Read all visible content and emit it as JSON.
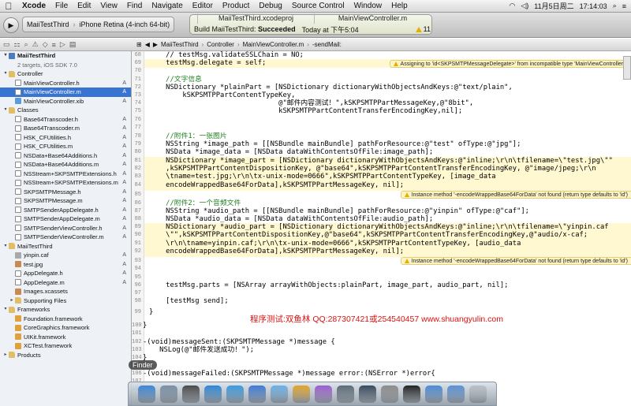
{
  "menubar": {
    "apple": "",
    "items": [
      "Xcode",
      "File",
      "Edit",
      "View",
      "Find",
      "Navigate",
      "Editor",
      "Product",
      "Debug",
      "Source Control",
      "Window",
      "Help"
    ],
    "status": {
      "clock": "17:14:03",
      "date": "11月5日周二"
    }
  },
  "toolbar": {
    "run_icon": "play-icon",
    "scheme_target": "MaiiTestThird",
    "scheme_device": "iPhone Retina (4-inch 64-bit)",
    "activity_tabs": [
      "MaiiTestThird.xcodeproj",
      "MainViewController.m"
    ],
    "activity_status_prefix": "Build MaiiTestThird:",
    "activity_status": "Succeeded",
    "activity_time": "Today at 下午5:04",
    "warning_count": "11"
  },
  "navigator": {
    "project": "MaiiTestThird",
    "project_sub": "2 targets, iOS SDK 7.0",
    "items": [
      {
        "label": "Controller",
        "kind": "folder",
        "indent": 1,
        "disc": "▾",
        "status": ""
      },
      {
        "label": "MainViewController.h",
        "kind": "h",
        "indent": 2,
        "disc": "",
        "status": "A"
      },
      {
        "label": "MainViewController.m",
        "kind": "m",
        "indent": 2,
        "disc": "",
        "status": "A",
        "selected": true
      },
      {
        "label": "MainViewController.xib",
        "kind": "xib",
        "indent": 2,
        "disc": "",
        "status": "A"
      },
      {
        "label": "Classes",
        "kind": "folder",
        "indent": 1,
        "disc": "▾",
        "status": ""
      },
      {
        "label": "Base64Transcoder.h",
        "kind": "h",
        "indent": 2,
        "disc": "",
        "status": "A"
      },
      {
        "label": "Base64Transcoder.m",
        "kind": "m",
        "indent": 2,
        "disc": "",
        "status": "A"
      },
      {
        "label": "HSK_CFUtilities.h",
        "kind": "h",
        "indent": 2,
        "disc": "",
        "status": "A"
      },
      {
        "label": "HSK_CFUtilities.m",
        "kind": "m",
        "indent": 2,
        "disc": "",
        "status": "A"
      },
      {
        "label": "NSData+Base64Additions.h",
        "kind": "h",
        "indent": 2,
        "disc": "",
        "status": "A"
      },
      {
        "label": "NSData+Base64Additions.m",
        "kind": "m",
        "indent": 2,
        "disc": "",
        "status": "A"
      },
      {
        "label": "NSStream+SKPSMTPExtensions.h",
        "kind": "h",
        "indent": 2,
        "disc": "",
        "status": "A"
      },
      {
        "label": "NSStream+SKPSMTPExtensions.m",
        "kind": "m",
        "indent": 2,
        "disc": "",
        "status": "A"
      },
      {
        "label": "SKPSMTPMessage.h",
        "kind": "h",
        "indent": 2,
        "disc": "",
        "status": "A"
      },
      {
        "label": "SKPSMTPMessage.m",
        "kind": "m",
        "indent": 2,
        "disc": "",
        "status": "A"
      },
      {
        "label": "SMTPSenderAppDelegate.h",
        "kind": "h",
        "indent": 2,
        "disc": "",
        "status": "A"
      },
      {
        "label": "SMTPSenderAppDelegate.m",
        "kind": "m",
        "indent": 2,
        "disc": "",
        "status": "A"
      },
      {
        "label": "SMTPSenderViewController.h",
        "kind": "h",
        "indent": 2,
        "disc": "",
        "status": "A"
      },
      {
        "label": "SMTPSenderViewController.m",
        "kind": "m",
        "indent": 2,
        "disc": "",
        "status": "A"
      },
      {
        "label": "MaiiTestThird",
        "kind": "folder",
        "indent": 1,
        "disc": "▾",
        "status": ""
      },
      {
        "label": "yinpin.caf",
        "kind": "caf",
        "indent": 2,
        "disc": "",
        "status": "A"
      },
      {
        "label": "test.jpg",
        "kind": "img",
        "indent": 2,
        "disc": "",
        "status": "A"
      },
      {
        "label": "AppDelegate.h",
        "kind": "h",
        "indent": 2,
        "disc": "",
        "status": "A"
      },
      {
        "label": "AppDelegate.m",
        "kind": "m",
        "indent": 2,
        "disc": "",
        "status": "A"
      },
      {
        "label": "Images.xcassets",
        "kind": "img",
        "indent": 2,
        "disc": "",
        "status": ""
      },
      {
        "label": "Supporting Files",
        "kind": "folder",
        "indent": 2,
        "disc": "▸",
        "status": ""
      },
      {
        "label": "Frameworks",
        "kind": "folder",
        "indent": 1,
        "disc": "▾",
        "status": ""
      },
      {
        "label": "Foundation.framework",
        "kind": "fw",
        "indent": 2,
        "disc": "",
        "status": ""
      },
      {
        "label": "CoreGraphics.framework",
        "kind": "fw",
        "indent": 2,
        "disc": "",
        "status": ""
      },
      {
        "label": "UIKit.framework",
        "kind": "fw",
        "indent": 2,
        "disc": "",
        "status": ""
      },
      {
        "label": "XCTest.framework",
        "kind": "fw",
        "indent": 2,
        "disc": "",
        "status": ""
      },
      {
        "label": "Products",
        "kind": "folder",
        "indent": 1,
        "disc": "▸",
        "status": ""
      }
    ]
  },
  "editor": {
    "breadcrumbs": [
      "MaiiTestThird",
      "Controller",
      "MainViewController.m",
      "-sendMail:"
    ],
    "line_numbers": [
      {
        "n": "68"
      },
      {
        "n": "69"
      },
      {
        "n": "70"
      },
      {
        "n": "71"
      },
      {
        "n": "72"
      },
      {
        "n": "73"
      },
      {
        "n": "74"
      },
      {
        "n": "75"
      },
      {
        "n": "76"
      },
      {
        "n": "77"
      },
      {
        "n": "78"
      },
      {
        "n": "79"
      },
      {
        "n": "80"
      },
      {
        "n": "81"
      },
      {
        "n": "82"
      },
      {
        "n": "83"
      },
      {
        "n": "84"
      },
      {
        "n": "85"
      },
      {
        "n": "86"
      },
      {
        "n": "87"
      },
      {
        "n": "88"
      },
      {
        "n": "89"
      },
      {
        "n": "90"
      },
      {
        "n": "91"
      },
      {
        "n": "92"
      },
      {
        "n": "93"
      },
      {
        "n": "94"
      },
      {
        "n": "95"
      },
      {
        "n": "96"
      },
      {
        "n": "97"
      },
      {
        "n": "98"
      },
      {
        "n": "99"
      },
      {
        "n": "100"
      },
      {
        "n": "101"
      },
      {
        "n": "102"
      },
      {
        "n": "103"
      },
      {
        "n": "104"
      },
      {
        "n": "105"
      },
      {
        "n": "106"
      },
      {
        "n": "107"
      },
      {
        "n": "108"
      }
    ],
    "issues": [
      "Assigning to 'id<SKPSMTPMessageDelegate>' from incompatible type 'MainViewController *'",
      "Instance method '-encodeWrappedBase64ForData' not found (return type defaults to 'id')",
      "Instance method '-encodeWrappedBase64ForData' not found (return type defaults to 'id')"
    ],
    "code": {
      "l1": "    // testMsg.validateSSLChain = NO;",
      "l2": "    testMsg.delegate = self;",
      "c1": "    //文字信息",
      "p1": "    NSDictionary *plainPart = [NSDictionary dictionaryWithObjectsAndKeys:@\"text/plain\",",
      "p2": "        kSKPSMTPPartContentTypeKey,",
      "p3": "                               @\"邮件内容测试！\",kSKPSMTPPartMessageKey,@\"8bit\",",
      "p4": "                               kSKPSMTPPartContentTransferEncodingKey,nil];",
      "c2": "    //附件1：一张图片",
      "i1": "    NSString *image_path = [[NSBundle mainBundle] pathForResource:@\"test\" ofType:@\"jpg\"];",
      "i2": "    NSData *image_data = [NSData dataWithContentsOfFile:image_path];",
      "i3": "    NSDictionary *image_part = [NSDictionary dictionaryWithObjectsAndKeys:@\"inline;\\r\\n\\tfilename=\\\"test.jpg\\\"\"",
      "i4": "    ,kSKPSMTPPartContentDispositionKey, @\"base64\",kSKPSMTPPartContentTransferEncodingKey, @\"image/jpeg;\\r\\n",
      "i5": "    \\tname=test.jpg;\\r\\n\\tx-unix-mode=0666\",kSKPSMTPPartContentTypeKey, [image_data",
      "i6": "    encodeWrappedBase64ForData],kSKPSMTPPartMessageKey, nil];",
      "c3": "    //附件2：一个音频文件",
      "a1": "    NSString *audio_path = [[NSBundle mainBundle] pathForResource:@\"yinpin\" ofType:@\"caf\"];",
      "a2": "    NSData *audio_data = [NSData dataWithContentsOfFile:audio_path];",
      "a3": "    NSDictionary *audio_part = [NSDictionary dictionaryWithObjectsAndKeys:@\"inline;\\r\\n\\tfilename=\\\"yinpin.caf",
      "a4": "    \\\"\",kSKPSMTPPartContentDispositionKey,@\"base64\",kSKPSMTPPartContentTransferEncodingKey,@\"audio/x-caf;",
      "a5": "    \\r\\n\\tname=yinpin.caf;\\r\\n\\tx-unix-mode=0666\",kSKPSMTPPartContentTypeKey, [audio_data",
      "a6": "    encodeWrappedBase64ForData],kSKPSMTPPartMessageKey, nil];",
      "s1": "    testMsg.parts = [NSArray arrayWithObjects:plainPart, image_part, audio_part, nil];",
      "s2": "    [testMsg send];",
      "b1": "}",
      "b2": "}",
      "m1": "-(void)messageSent:(SKPSMTPMessage *)message {",
      "m2": "    NSLog(@\"邮件发送成功！\");",
      "m3": "}",
      "m4": "-(void)messageFailed:(SKPSMTPMessage *)message error:(NSError *)error{"
    },
    "overlay_note": "程序测试:双鱼林 QQ:287307421或254540457 www.shuangyulin.com"
  },
  "dock": {
    "tooltip": "Finder",
    "icons": [
      "finder-icon",
      "launchpad-icon",
      "mission-control-icon",
      "app-store-icon",
      "safari-icon",
      "xcode-icon",
      "mail-icon",
      "photos-icon",
      "itunes-icon",
      "instruments-icon",
      "iphone-simulator-icon",
      "system-preferences-icon",
      "terminal-icon",
      "folder-icon",
      "downloads-icon",
      "trash-icon"
    ],
    "icon_colors": [
      "#3c86d8",
      "#7a8fa7",
      "#4a4a4a",
      "#2e88d8",
      "#3a9be0",
      "#3f7bd8",
      "#6cb0e6",
      "#e0a52c",
      "#9b5fd2",
      "#5d6c7a",
      "#384a5e",
      "#8c8c8c",
      "#222222",
      "#4d8cd6",
      "#5a92d6",
      "#b8c0c8"
    ]
  }
}
